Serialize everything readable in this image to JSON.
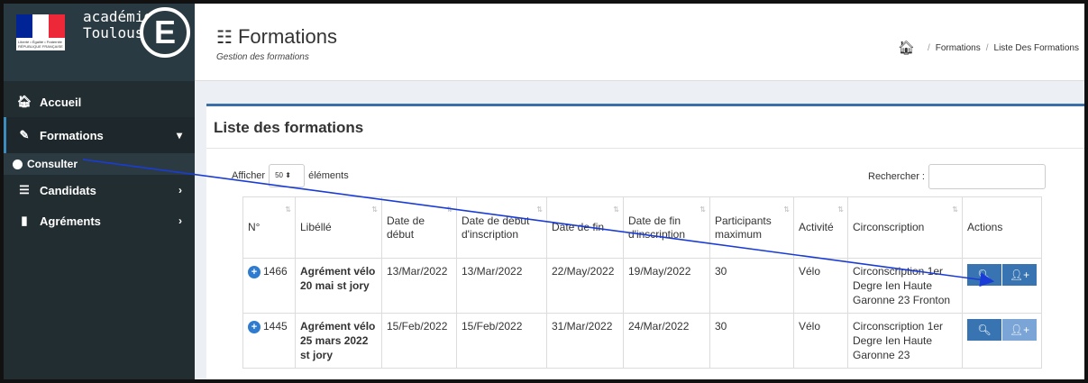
{
  "brand": {
    "flag_text": "Liberté • Égalité • Fraternité RÉPUBLIQUE FRANÇAISE",
    "line1": "académie",
    "line2": "Toulouse",
    "letter": "E"
  },
  "sidebar": {
    "items": [
      {
        "label": "Accueil",
        "icon": "home-icon"
      },
      {
        "label": "Formations",
        "icon": "edit-icon",
        "chevron": "⌄"
      },
      {
        "label": "Candidats",
        "icon": "list-icon",
        "chevron": "›"
      },
      {
        "label": "Agréments",
        "icon": "file-icon",
        "chevron": "›"
      }
    ],
    "submenu_label": "Consulter"
  },
  "header": {
    "title": "Formations",
    "subtitle": "Gestion des formations",
    "breadcrumb": [
      "Formations",
      "Liste Des Formations"
    ]
  },
  "box": {
    "title": "Liste des formations",
    "show_prefix": "Afficher",
    "show_value": "50",
    "show_suffix": "éléments",
    "search_label": "Rechercher :"
  },
  "table": {
    "headers": [
      "N°",
      "Libéllé",
      "Date de début",
      "Date de début d'inscription",
      "Date de fin",
      "Date de fin d'inscription",
      "Participants maximum",
      "Activité",
      "Circonscription",
      "Actions"
    ],
    "rows": [
      {
        "num": "1466",
        "libelle": "Agrément vélo 20 mai st jory",
        "debut": "13/Mar/2022",
        "debut_inscr": "13/Mar/2022",
        "fin": "22/May/2022",
        "fin_inscr": "19/May/2022",
        "max": "30",
        "activite": "Vélo",
        "circ": "Circonscription 1er Degre Ien Haute Garonne 23 Fronton"
      },
      {
        "num": "1445",
        "libelle": "Agrément vélo 25 mars 2022 st jory",
        "debut": "15/Feb/2022",
        "debut_inscr": "15/Feb/2022",
        "fin": "31/Mar/2022",
        "fin_inscr": "24/Mar/2022",
        "max": "30",
        "activite": "Vélo",
        "circ": "Circonscription 1er Degre Ien Haute Garonne 23"
      }
    ]
  },
  "colors": {
    "sidebar_bg": "#222d32",
    "accent": "#3c8dbc",
    "button": "#3874b2",
    "annotation_arrow": "#1a3cd6"
  }
}
